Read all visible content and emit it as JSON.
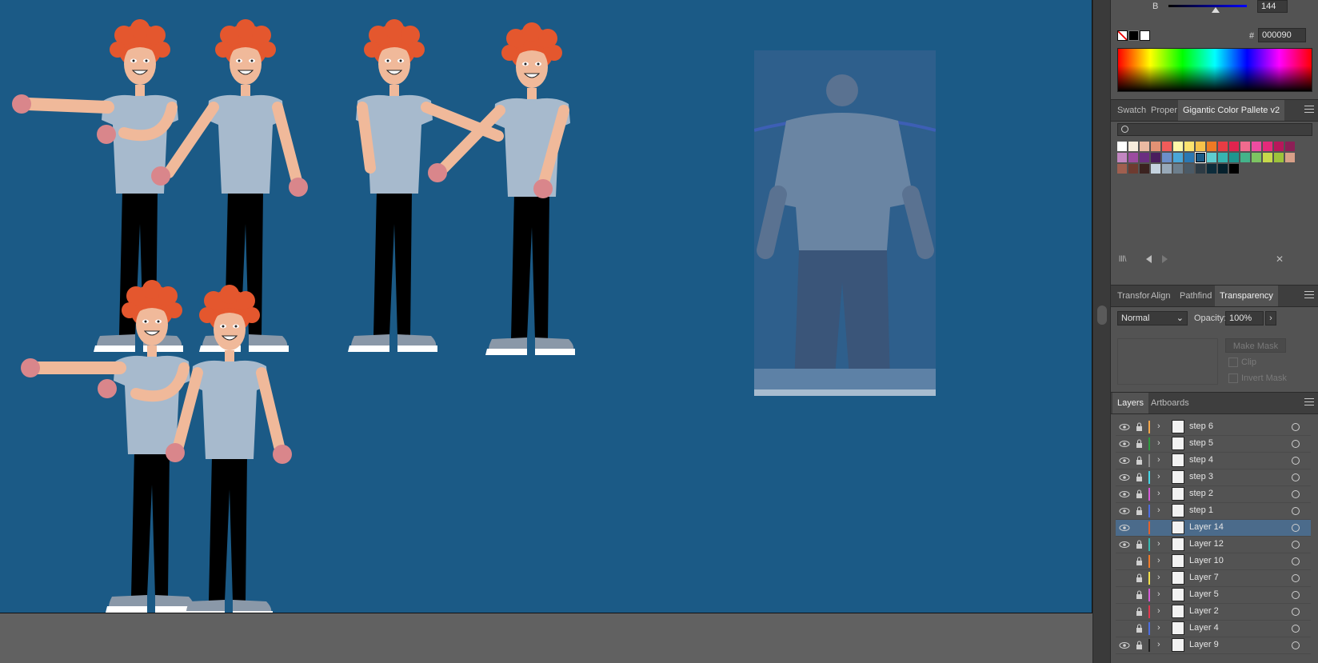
{
  "color_panel": {
    "channel_label": "B",
    "channel_value": "144",
    "hex_label": "#",
    "hex_value": "000090"
  },
  "swatch_panel": {
    "tabs": [
      "Swatch",
      "Proper",
      "Gigantic Color Pallete v2"
    ],
    "active_tab": "Gigantic Color Pallete v2",
    "swatches": [
      "#ffffff",
      "#f7ecdd",
      "#eab9a2",
      "#e39274",
      "#f05c5a",
      "#fff7a8",
      "#fde36f",
      "#f7c24a",
      "#ee7a24",
      "#e83c44",
      "#e0244e",
      "#f06b8e",
      "#ee4ca1",
      "#e52a7b",
      "#b8175b",
      "#8c1f56",
      "#c286c1",
      "#9b4b9f",
      "#6b2f81",
      "#4a1d5e",
      "#6c8fc9",
      "#4aa6d8",
      "#2b78b3",
      "#1b5a86",
      "#5fcdd0",
      "#36b5b1",
      "#1e9690",
      "#44b38a",
      "#7dc462",
      "#c7d94b",
      "#9dc33b",
      "#d8a088",
      "#a05f4f",
      "#6e3b30",
      "#3b2320",
      "#c5d3df",
      "#98a9b8",
      "#6d7f8d",
      "#4b5a66",
      "#2d3b45",
      "#0c2c3b",
      "#05202c",
      "#000000"
    ],
    "selected_swatch": "#1b5a86"
  },
  "transparency_panel": {
    "tabs": [
      "Transfor",
      "Align",
      "Pathfind",
      "Transparency"
    ],
    "active_tab": "Transparency",
    "blend_mode": "Normal",
    "opacity_label": "Opacity:",
    "opacity_value": "100%",
    "make_mask_label": "Make Mask",
    "clip_label": "Clip",
    "invert_mask_label": "Invert Mask"
  },
  "layers_panel": {
    "tabs": [
      "Layers",
      "Artboards"
    ],
    "active_tab": "Layers",
    "layers": [
      {
        "name": "step 6",
        "color": "#f3a64a",
        "visible": true,
        "selected": false,
        "expandable": true
      },
      {
        "name": "step 5",
        "color": "#2e9a3f",
        "visible": true,
        "selected": false,
        "expandable": true
      },
      {
        "name": "step 4",
        "color": "#8a8a8a",
        "visible": true,
        "selected": false,
        "expandable": true
      },
      {
        "name": "step 3",
        "color": "#46d6e8",
        "visible": true,
        "selected": false,
        "expandable": true
      },
      {
        "name": "step 2",
        "color": "#d65bd8",
        "visible": true,
        "selected": false,
        "expandable": true
      },
      {
        "name": "step 1",
        "color": "#4d6ee0",
        "visible": true,
        "selected": false,
        "expandable": true
      },
      {
        "name": "Layer 14",
        "color": "#e2622d",
        "visible": true,
        "selected": true,
        "expandable": false
      },
      {
        "name": "Layer 12",
        "color": "#36b7b0",
        "visible": true,
        "selected": false,
        "expandable": true
      },
      {
        "name": "Layer 10",
        "color": "#f07b2a",
        "visible": false,
        "selected": false,
        "expandable": true
      },
      {
        "name": "Layer 7",
        "color": "#f4e14a",
        "visible": false,
        "selected": false,
        "expandable": true
      },
      {
        "name": "Layer 5",
        "color": "#d65bd8",
        "visible": false,
        "selected": false,
        "expandable": true
      },
      {
        "name": "Layer 2",
        "color": "#e0374d",
        "visible": false,
        "selected": false,
        "expandable": true
      },
      {
        "name": "Layer 4",
        "color": "#4d6ee0",
        "visible": false,
        "selected": false,
        "expandable": true
      },
      {
        "name": "Layer 9",
        "color": "#222222",
        "visible": true,
        "selected": false,
        "expandable": true
      }
    ]
  },
  "colors": {
    "artboard_bg": "#1b5a86",
    "hair": "#e4572e",
    "skin": "#f0b99a",
    "shirt": "#a7bacd",
    "pants": "#000000",
    "shoe": "#8a98a8",
    "hand": "#d9868b"
  }
}
